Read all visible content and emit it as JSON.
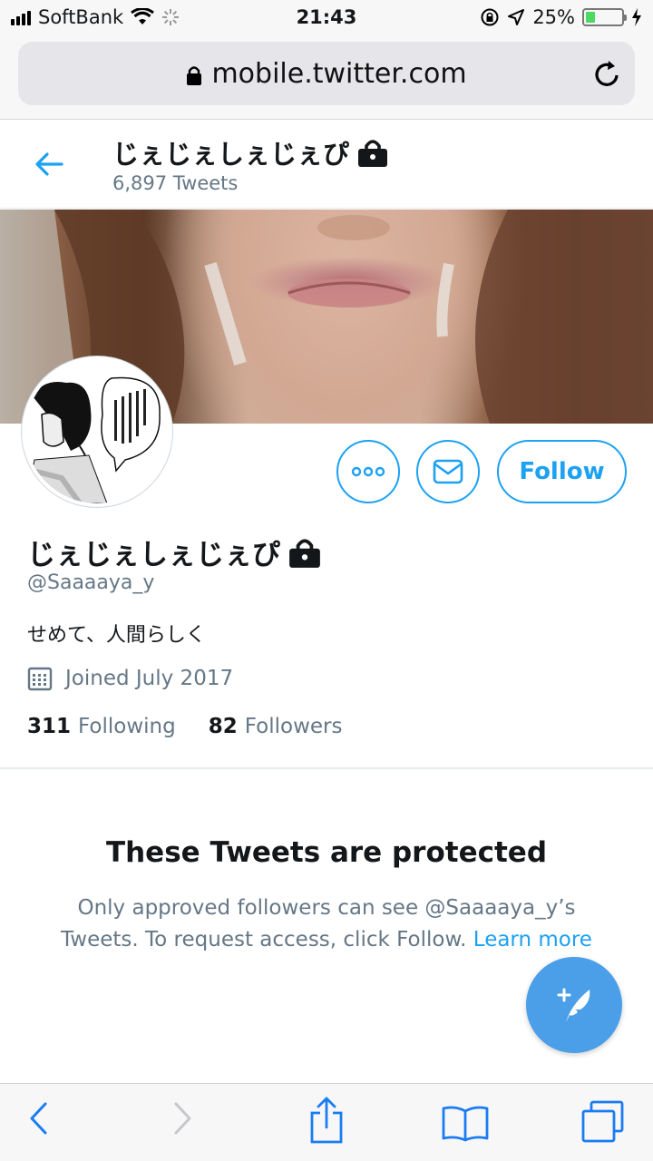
{
  "status_bar": {
    "carrier": "SoftBank",
    "time": "21:43",
    "battery_percent": "25%",
    "battery_level": 0.25,
    "battery_color": "#4cd964"
  },
  "browser": {
    "url": "mobile.twitter.com"
  },
  "header": {
    "name": "じぇじぇしぇじぇぴ",
    "tweet_count": "6,897 Tweets"
  },
  "profile": {
    "name": "じぇじぇしぇじぇぴ",
    "handle": "@Saaaaya_y",
    "bio": "せめて、人間らしく",
    "joined": "Joined July 2017",
    "following_count": "311",
    "following_label": "Following",
    "followers_count": "82",
    "followers_label": "Followers",
    "follow_button": "Follow"
  },
  "protected": {
    "title": "These Tweets are protected",
    "message": "Only approved followers can see @Saaaaya_y’s Tweets. To request access, click Follow.",
    "learn_more": "Learn more"
  },
  "colors": {
    "accent": "#1da1f2",
    "fab": "#4a9fe8",
    "secondary_text": "#657786"
  },
  "icons": {
    "header_back": "back-arrow-icon",
    "more": "more-icon",
    "message": "envelope-icon",
    "calendar": "calendar-icon",
    "compose": "compose-tweet-icon",
    "browser_back": "chevron-left-icon",
    "browser_forward": "chevron-right-icon",
    "share": "share-icon",
    "bookmarks": "bookmarks-icon",
    "tabs": "tabs-icon"
  }
}
